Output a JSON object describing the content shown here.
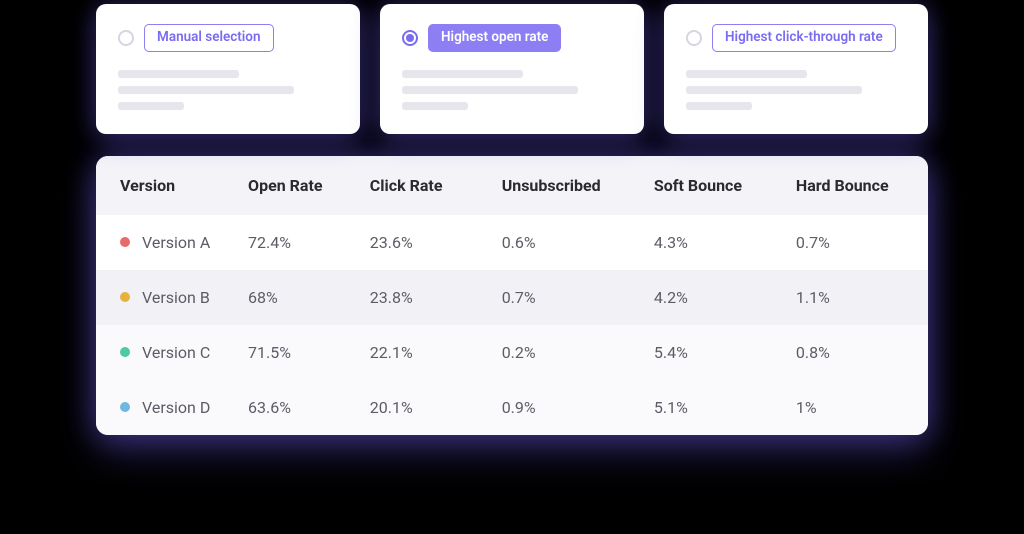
{
  "options": [
    {
      "label": "Manual selection",
      "selected": false
    },
    {
      "label": "Highest open rate",
      "selected": true
    },
    {
      "label": "Highest click-through rate",
      "selected": false
    }
  ],
  "table": {
    "headers": {
      "version": "Version",
      "open_rate": "Open Rate",
      "click_rate": "Click Rate",
      "unsubscribed": "Unsubscribed",
      "soft_bounce": "Soft Bounce",
      "hard_bounce": "Hard Bounce"
    },
    "rows": [
      {
        "color": "#e86a6a",
        "version": "Version A",
        "open_rate": "72.4%",
        "click_rate": "23.6%",
        "unsubscribed": "0.6%",
        "soft_bounce": "4.3%",
        "hard_bounce": "0.7%"
      },
      {
        "color": "#e6b23c",
        "version": "Version B",
        "open_rate": "68%",
        "click_rate": "23.8%",
        "unsubscribed": "0.7%",
        "soft_bounce": "4.2%",
        "hard_bounce": "1.1%"
      },
      {
        "color": "#4fc9a2",
        "version": "Version C",
        "open_rate": "71.5%",
        "click_rate": "22.1%",
        "unsubscribed": "0.2%",
        "soft_bounce": "5.4%",
        "hard_bounce": "0.8%"
      },
      {
        "color": "#6fb8e0",
        "version": "Version D",
        "open_rate": "63.6%",
        "click_rate": "20.1%",
        "unsubscribed": "0.9%",
        "soft_bounce": "5.1%",
        "hard_bounce": "1%"
      }
    ]
  }
}
